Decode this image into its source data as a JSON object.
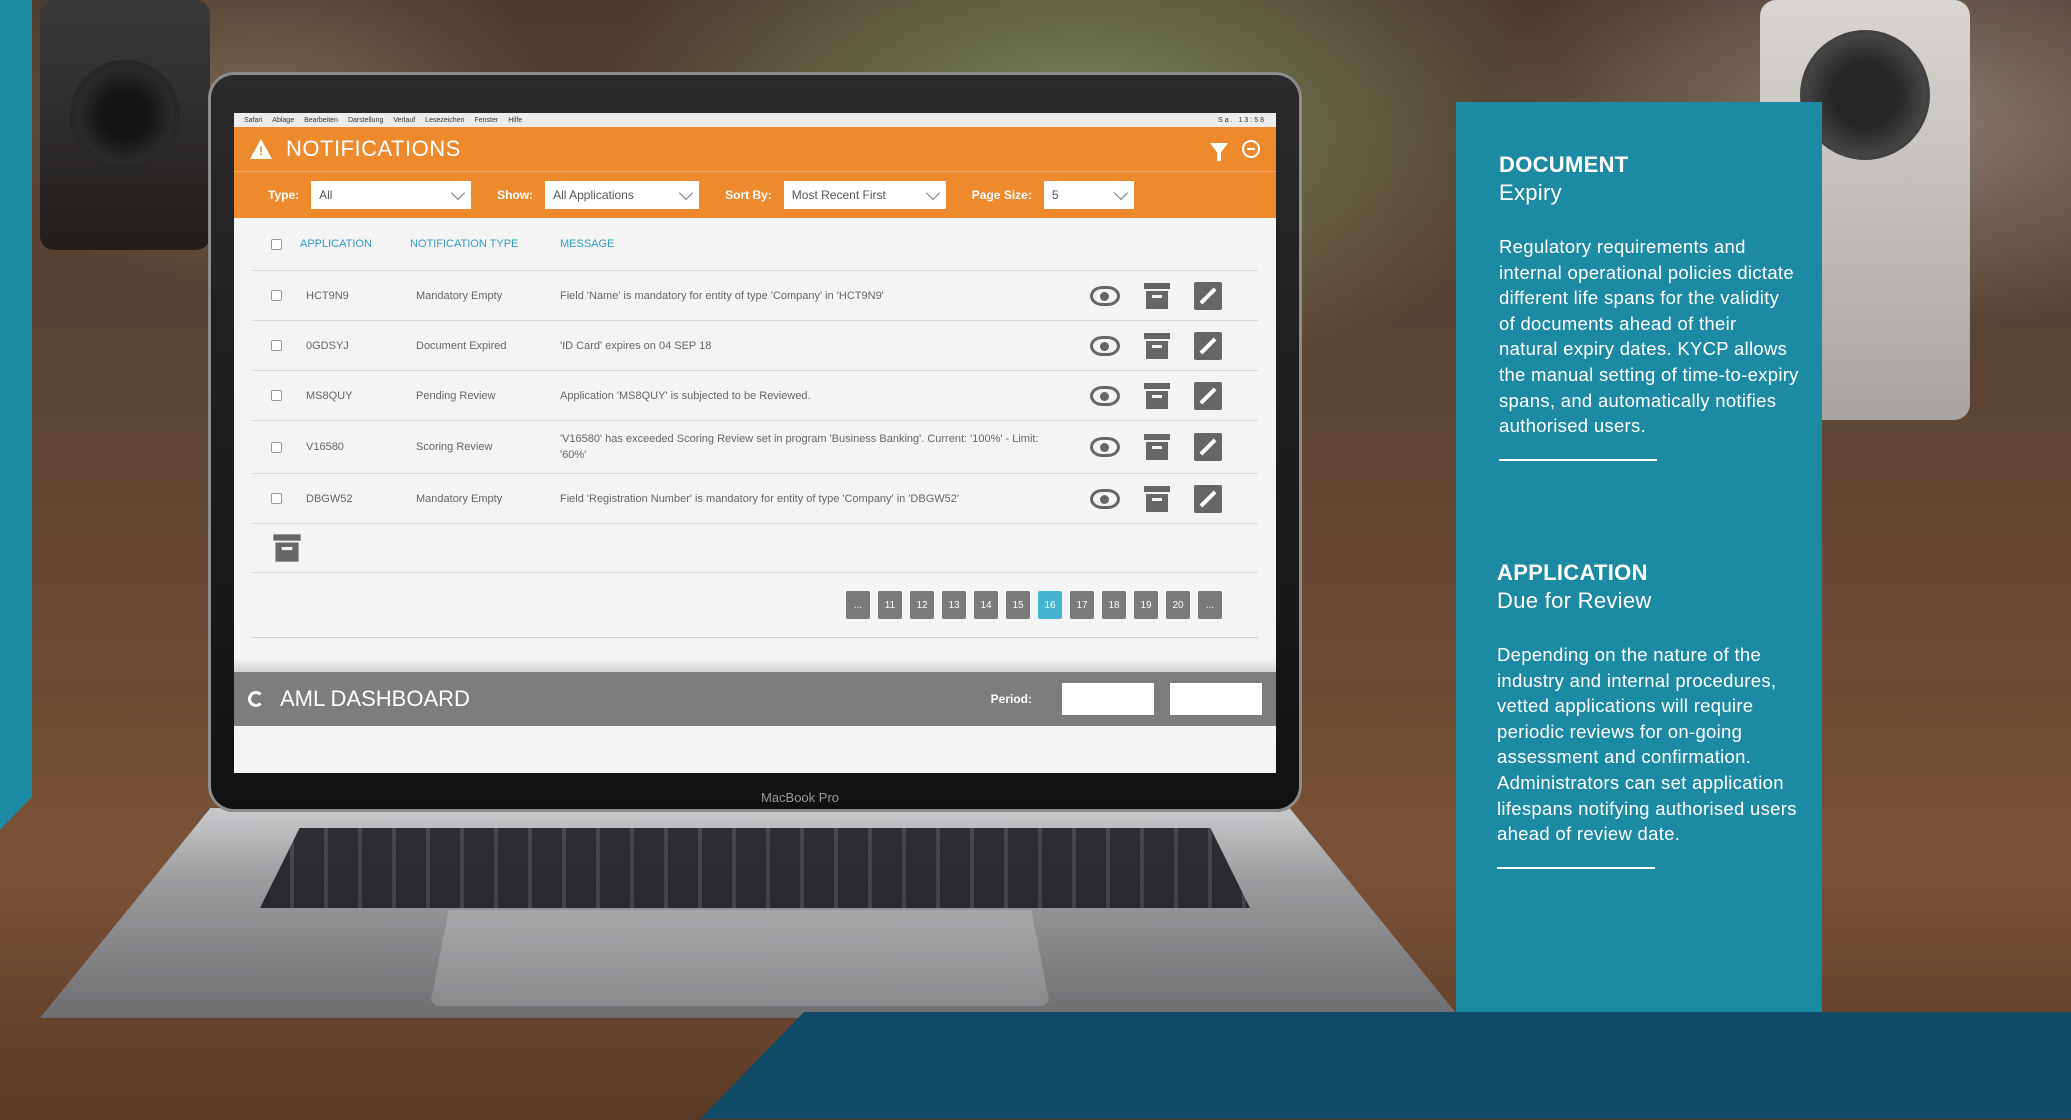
{
  "screen": {
    "menubar": {
      "items": [
        "Safari",
        "Ablage",
        "Bearbeiten",
        "Darstellung",
        "Verlauf",
        "Lesezeichen",
        "Fenster",
        "Hilfe"
      ],
      "status": "Sa. 13:58"
    },
    "notifications": {
      "title": "NOTIFICATIONS",
      "filters": {
        "type_label": "Type:",
        "type_value": "All",
        "show_label": "Show:",
        "show_value": "All Applications",
        "sort_label": "Sort By:",
        "sort_value": "Most Recent First",
        "page_size_label": "Page Size:",
        "page_size_value": "5"
      },
      "columns": [
        "APPLICATION",
        "NOTIFICATION TYPE",
        "MESSAGE"
      ],
      "rows": [
        {
          "application": "HCT9N9",
          "type": "Mandatory Empty",
          "message": "Field 'Name' is mandatory for entity of type 'Company' in 'HCT9N9'"
        },
        {
          "application": "0GDSYJ",
          "type": "Document Expired",
          "message": "'ID Card' expires on 04 SEP 18"
        },
        {
          "application": "MS8QUY",
          "type": "Pending Review",
          "message": "Application 'MS8QUY' is subjected to be Reviewed."
        },
        {
          "application": "V16580",
          "type": "Scoring Review",
          "message": "'V16580' has exceeded Scoring Review set in program 'Business Banking'. Current: '100%' - Limit: '60%'"
        },
        {
          "application": "DBGW52",
          "type": "Mandatory Empty",
          "message": "Field 'Registration Number' is mandatory for entity of type 'Company' in 'DBGW52'"
        }
      ],
      "pagination": {
        "pages": [
          "...",
          "11",
          "12",
          "13",
          "14",
          "15",
          "16",
          "17",
          "18",
          "19",
          "20",
          "..."
        ],
        "current": "16"
      }
    },
    "dashboard": {
      "title": "AML DASHBOARD",
      "period_label": "Period:"
    }
  },
  "laptop_label": "MacBook Pro",
  "panel": {
    "document": {
      "heading": "DOCUMENT",
      "subheading": "Expiry",
      "body": "Regulatory requirements and internal operational policies dictate different life spans for the validity of documents ahead of their natural expiry dates. KYCP allows the manual setting of time-to-expiry spans, and automatically notifies authorised users."
    },
    "application": {
      "heading": "APPLICATION",
      "subheading": "Due for Review",
      "body": "Depending on the nature of the industry and internal procedures, vetted applications will require periodic reviews for on-going assessment and confirmation. Administrators can set application lifespans notifying authorised users ahead of review date."
    }
  },
  "colors": {
    "accent_orange": "#ee8a2e",
    "teal": "#1d8aa3",
    "dark_navy": "#0f4a67",
    "active_page": "#45b5cf"
  }
}
